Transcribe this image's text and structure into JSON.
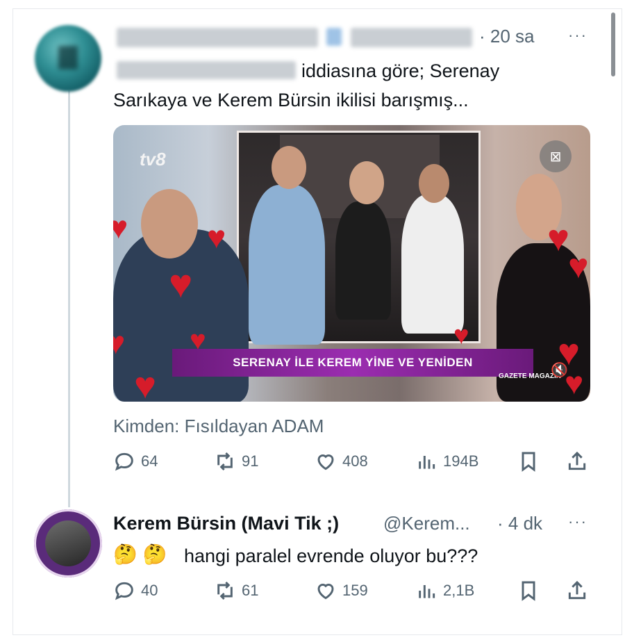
{
  "tweet1": {
    "time": "· 20 sa",
    "more": "···",
    "text_line1_suffix": "iddiasına göre; Serenay",
    "text_line2": "Sarıkaya ve Kerem Bürsin ikilisi barışmış...",
    "media": {
      "channel_logo": "tv8",
      "banner_text": "SERENAY İLE KEREM YİNE VE YENİDEN",
      "watermark": "GAZETE MAGAZİN",
      "icons": [
        "image-no-alt-icon",
        "mute-icon",
        "heart-decoration"
      ]
    },
    "source": "Kimden: Fısıldayan ADAM",
    "actions": {
      "replies": "64",
      "retweets": "91",
      "likes": "408",
      "views": "194B"
    }
  },
  "tweet2": {
    "name": "Kerem Bürsin (Mavi Tik ;)",
    "handle": "@Kerem...",
    "time": "· 4 dk",
    "more": "···",
    "emoji": "🤔 🤔",
    "text": "hangi paralel evrende oluyor bu???",
    "actions": {
      "replies": "40",
      "retweets": "61",
      "likes": "159",
      "views": "2,1B"
    }
  },
  "colors": {
    "text": "#0f1419",
    "secondary": "#536471",
    "thread_line": "#cfd9de",
    "banner": "#9b2db0",
    "heart": "#d61c2a"
  }
}
